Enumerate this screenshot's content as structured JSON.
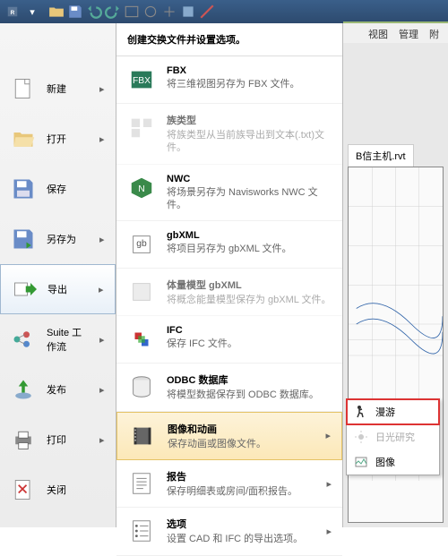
{
  "titlebar": {
    "app": "R"
  },
  "ribbon": {
    "tabs": [
      "视图",
      "管理",
      "附"
    ]
  },
  "app_menu": {
    "items": [
      {
        "label": "新建"
      },
      {
        "label": "打开"
      },
      {
        "label": "保存"
      },
      {
        "label": "另存为"
      },
      {
        "label": "导出"
      },
      {
        "label": "Suite 工作流"
      },
      {
        "label": "发布"
      },
      {
        "label": "打印"
      },
      {
        "label": "关闭"
      }
    ]
  },
  "submenu": {
    "header": "创建交换文件并设置选项。",
    "items": [
      {
        "title": "FBX",
        "desc": "将三维视图另存为 FBX 文件。"
      },
      {
        "title": "族类型",
        "desc": "将族类型从当前族导出到文本(.txt)文件。",
        "disabled": true
      },
      {
        "title": "NWC",
        "desc": "将场景另存为 Navisworks NWC 文件。"
      },
      {
        "title": "gbXML",
        "desc": "将项目另存为 gbXML 文件。"
      },
      {
        "title": "体量模型 gbXML",
        "desc": "将概念能量模型保存为 gbXML 文件。",
        "disabled": true
      },
      {
        "title": "IFC",
        "desc": "保存 IFC 文件。"
      },
      {
        "title": "ODBC 数据库",
        "desc": "将模型数据保存到 ODBC 数据库。"
      },
      {
        "title": "图像和动画",
        "desc": "保存动画或图像文件。",
        "hover": true
      },
      {
        "title": "报告",
        "desc": "保存明细表或房间/面积报告。"
      },
      {
        "title": "选项",
        "desc": "设置 CAD 和 IFC 的导出选项。"
      }
    ]
  },
  "canvas": {
    "filename": "B信主机.rvt"
  },
  "flyout": {
    "items": [
      {
        "label": "漫游",
        "hl": true
      },
      {
        "label": "日光研究",
        "disabled": true
      },
      {
        "label": "图像"
      }
    ]
  }
}
